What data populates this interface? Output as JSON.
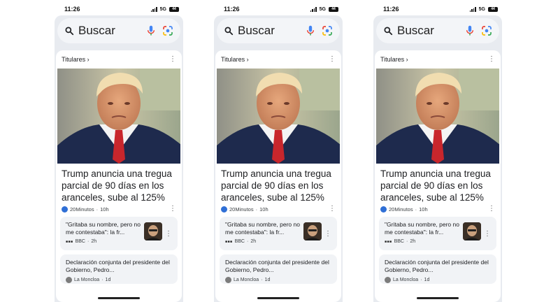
{
  "status": {
    "time": "11:26",
    "network": "5G",
    "battery": "44"
  },
  "search": {
    "label": "Buscar"
  },
  "card": {
    "section": "Titulares ›",
    "headline": "Trump anuncia una tregua parcial de 90 días en los aranceles, sube al 125% lo...",
    "source": "20Minutos",
    "age": "10h"
  },
  "related": [
    {
      "title": "\"Gritaba su nombre, pero no me contestaba\": la fr...",
      "source": "BBC",
      "age": "2h"
    },
    {
      "title": "Declaración conjunta del presidente del Gobierno, Pedro...",
      "source": "La Moncloa",
      "age": "1d"
    }
  ],
  "icons": {
    "more": "more-vertical-icon",
    "mic": "mic-icon",
    "lens": "lens-icon",
    "search": "search-icon"
  }
}
